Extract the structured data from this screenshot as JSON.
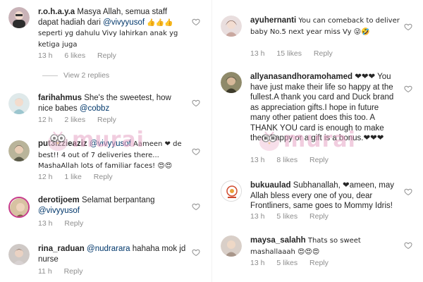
{
  "left": [
    {
      "username": "r.o.h.a.y.a",
      "text": "Masya Allah, semua staff dapat hadiah dari ",
      "mention": "@vivyyusof",
      "text2": " 👍👍👍 seperti yg dahulu Vivy lahirkan anak yg ketiga juga",
      "time": "13 h",
      "likes": "6 likes",
      "reply": "Reply",
      "view_replies": "View 2 replies"
    },
    {
      "username": "farihahmus",
      "text": "She's the sweetest, how nice babes ",
      "mention": "@cobbz",
      "time": "12 h",
      "likes": "2 likes",
      "reply": "Reply"
    },
    {
      "username": "put3izzieaziz",
      "text_before": " ",
      "mention": "@vivyyusof",
      "text": " Aameen ❤ de best!! 4 out of 7 deliveries there... MashaAllah lots of familiar faces! 😍😍",
      "time": "12 h",
      "likes": "1 like",
      "reply": "Reply"
    },
    {
      "username": "derotijoem",
      "text": "Selamat berpantang ",
      "mention": "@vivyyusof",
      "time": "13 h",
      "reply": "Reply"
    },
    {
      "username": "rina_raduan",
      "mention": "@nudrarara",
      "text": " hahaha mok jd nurse",
      "time": "11 h",
      "reply": "Reply"
    }
  ],
  "right": [
    {
      "username": "ayuhernanti",
      "text": "You can comeback to deliver baby No.5 next year miss Vy 😜🤣",
      "time": "13 h",
      "likes": "15 likes",
      "reply": "Reply"
    },
    {
      "username": "allyanasandhoramohamed",
      "text": " ❤❤❤ You have just make their life so happy at the fullest.A thank you card and Duck brand as appreciation gifts.I hope in future many other patient does this too. A THANK YOU card is enough to make them happy or a gift is a bonus.❤❤❤",
      "time": "13 h",
      "likes": "8 likes",
      "reply": "Reply"
    },
    {
      "username": "bukuaulad",
      "text": "Subhanallah, ❤ameen, may Allah bless every one of you, dear Frontliners, same goes to Mommy Idris!",
      "time": "13 h",
      "likes": "5 likes",
      "reply": "Reply"
    },
    {
      "username": "maysa_salahh",
      "text": "Thats so sweet mashallaaah 😍😍😍",
      "time": "13 h",
      "likes": "5 likes",
      "reply": "Reply"
    }
  ],
  "watermark": "murai",
  "colors": {
    "meta": "#8e8e8e",
    "mention": "#00376b",
    "heart_red": "#ed4956",
    "watermark": "#e6a6c6"
  }
}
